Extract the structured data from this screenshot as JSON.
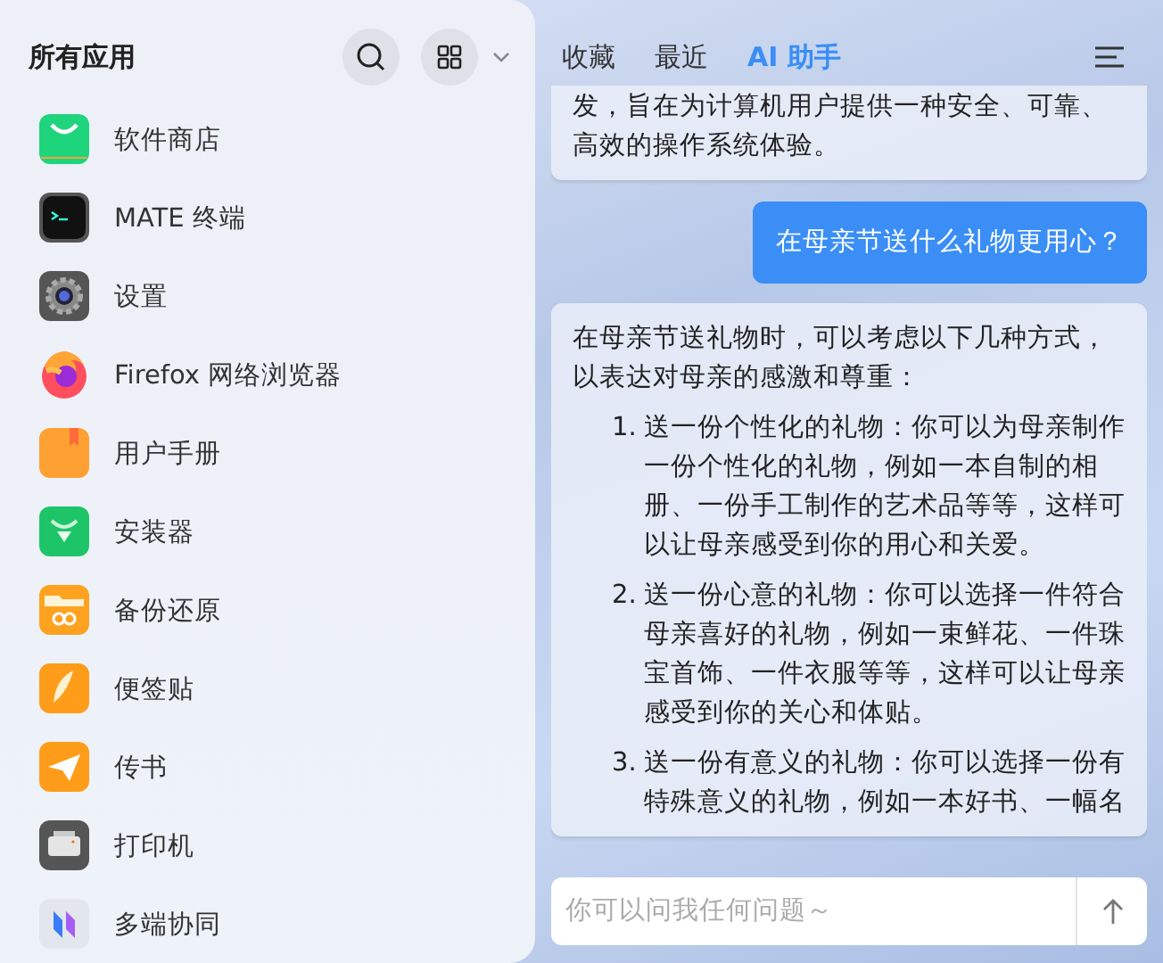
{
  "sidebar": {
    "title": "所有应用",
    "apps": [
      {
        "name": "软件商店"
      },
      {
        "name": "MATE 终端"
      },
      {
        "name": "设置"
      },
      {
        "name": "Firefox 网络浏览器"
      },
      {
        "name": "用户手册"
      },
      {
        "name": "安装器"
      },
      {
        "name": "备份还原"
      },
      {
        "name": "便签贴"
      },
      {
        "name": "传书"
      },
      {
        "name": "打印机"
      },
      {
        "name": "多端协同"
      }
    ]
  },
  "tabs": [
    {
      "label": "收藏",
      "selected": false
    },
    {
      "label": "最近",
      "selected": false
    },
    {
      "label": "AI 助手",
      "selected": true
    }
  ],
  "messages": [
    {
      "kind": "assistant",
      "text": "发，旨在为计算机用户提供一种安全、可靠、高效的操作系统体验。"
    },
    {
      "kind": "user",
      "text": "在母亲节送什么礼物更用心？"
    },
    {
      "kind": "assistant",
      "text": "在母亲节送礼物时，可以考虑以下几种方式，以表达对母亲的感激和尊重：",
      "items": [
        {
          "number": "1.",
          "text": "送一份个性化的礼物：你可以为母亲制作一份个性化的礼物，例如一本自制的相册、一份手工制作的艺术品等等，这样可以让母亲感受到你的用心和关爱。"
        },
        {
          "number": "2.",
          "text": "送一份心意的礼物：你可以选择一件符合母亲喜好的礼物，例如一束鲜花、一件珠宝首饰、一件衣服等等，这样可以让母亲感受到你的关心和体贴。"
        },
        {
          "number": "3.",
          "text": "送一份有意义的礼物：你可以选择一份有特殊意义的礼物，例如一本好书、一幅名"
        }
      ]
    }
  ],
  "input": {
    "placeholder": "你可以问我任何问题～"
  }
}
